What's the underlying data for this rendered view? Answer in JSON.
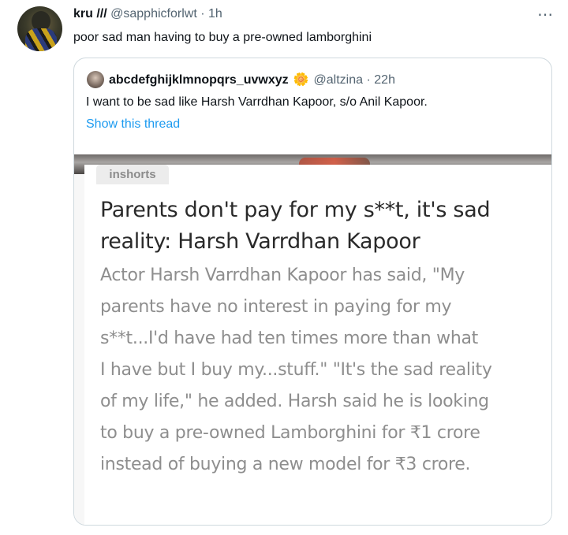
{
  "tweet": {
    "name": "kru ///",
    "handle": "@sapphicforlwt",
    "separator": "·",
    "time": "1h",
    "more_icon": "⋯",
    "text": "poor sad man having to buy a pre-owned lamborghini"
  },
  "quoted_tweet": {
    "name": "abcdefghijklmnopqrs_uvwxyz",
    "emoji": "🌼",
    "handle": "@altzina",
    "separator": "·",
    "time": "22h",
    "text": "I want to be sad like Harsh Varrdhan Kapoor, s/o Anil Kapoor.",
    "show_thread": "Show this thread"
  },
  "news_card": {
    "source": "inshorts",
    "headline_lines": [
      "Parents don't pay for my s**t, it's sad",
      "reality: Harsh Varrdhan Kapoor"
    ],
    "body_lines": [
      "Actor Harsh Varrdhan Kapoor has said, \"My",
      "parents have no interest in paying for my",
      "s**t...I'd have had ten times more than what",
      "I have but I buy my...stuff.\" \"It's the sad reality",
      "of my life,\" he added. Harsh said he is looking",
      "to buy a pre-owned Lamborghini for ₹1 crore",
      "instead of buying a new model for ₹3 crore."
    ]
  },
  "colors": {
    "text": "#0f1419",
    "secondary": "#536471",
    "link": "#1d9bf0",
    "border": "#cfd9de"
  }
}
